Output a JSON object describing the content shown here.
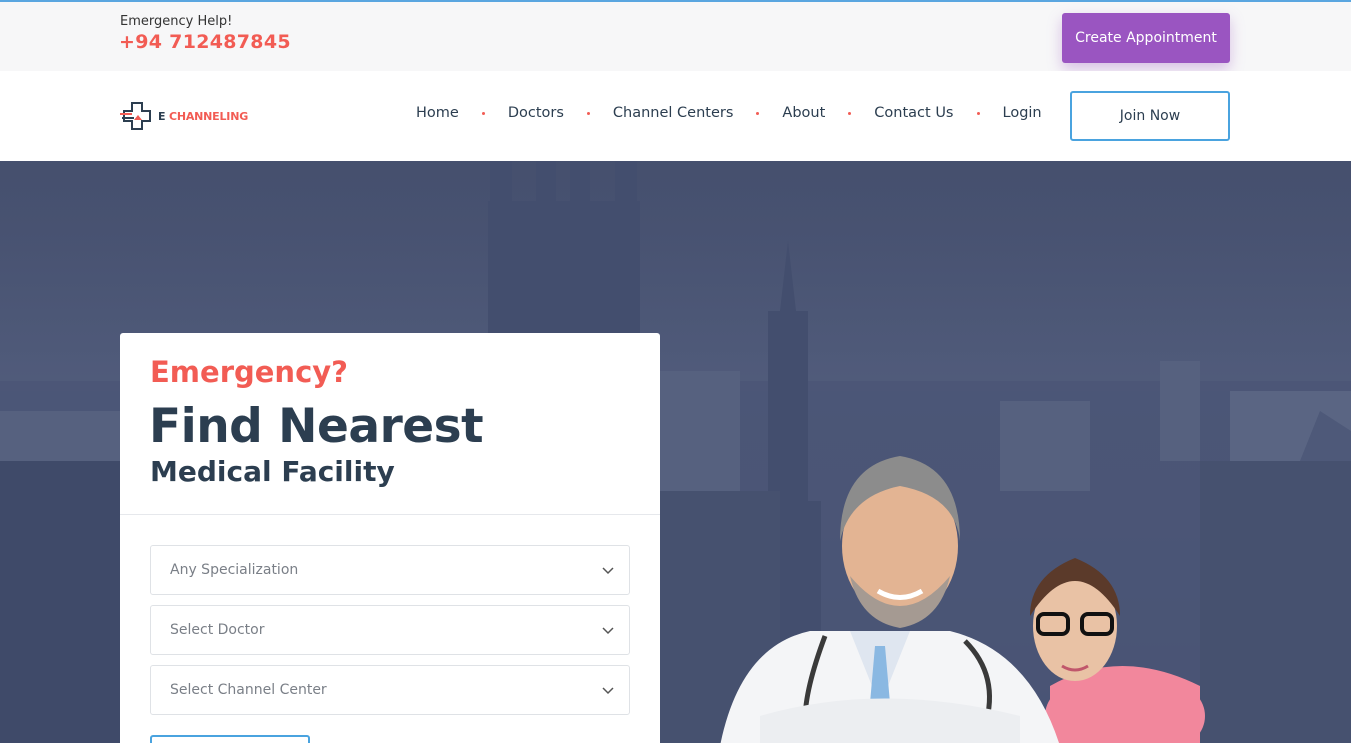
{
  "topbar": {
    "help_label": "Emergency Help!",
    "phone": "+94 712487845",
    "appointment_button": "Create Appointment"
  },
  "navbar": {
    "logo_text_prefix": "E",
    "logo_text": "CHANNELING",
    "items": [
      {
        "label": "Home"
      },
      {
        "label": "Doctors"
      },
      {
        "label": "Channel Centers"
      },
      {
        "label": "About"
      },
      {
        "label": "Contact Us"
      },
      {
        "label": "Login"
      }
    ],
    "join_button": "Join Now"
  },
  "hero": {
    "card": {
      "kicker": "Emergency?",
      "title": "Find Nearest",
      "subtitle": "Medical Facility",
      "selects": [
        {
          "value": "Any Specialization"
        },
        {
          "value": "Select Doctor"
        },
        {
          "value": "Select Channel Center"
        }
      ]
    }
  },
  "colors": {
    "accent_red": "#f25c54",
    "accent_purple": "#9a55c1",
    "accent_blue": "#4aa3df",
    "navy_text": "#2c3e50",
    "hero_bg": "#4a5678"
  }
}
